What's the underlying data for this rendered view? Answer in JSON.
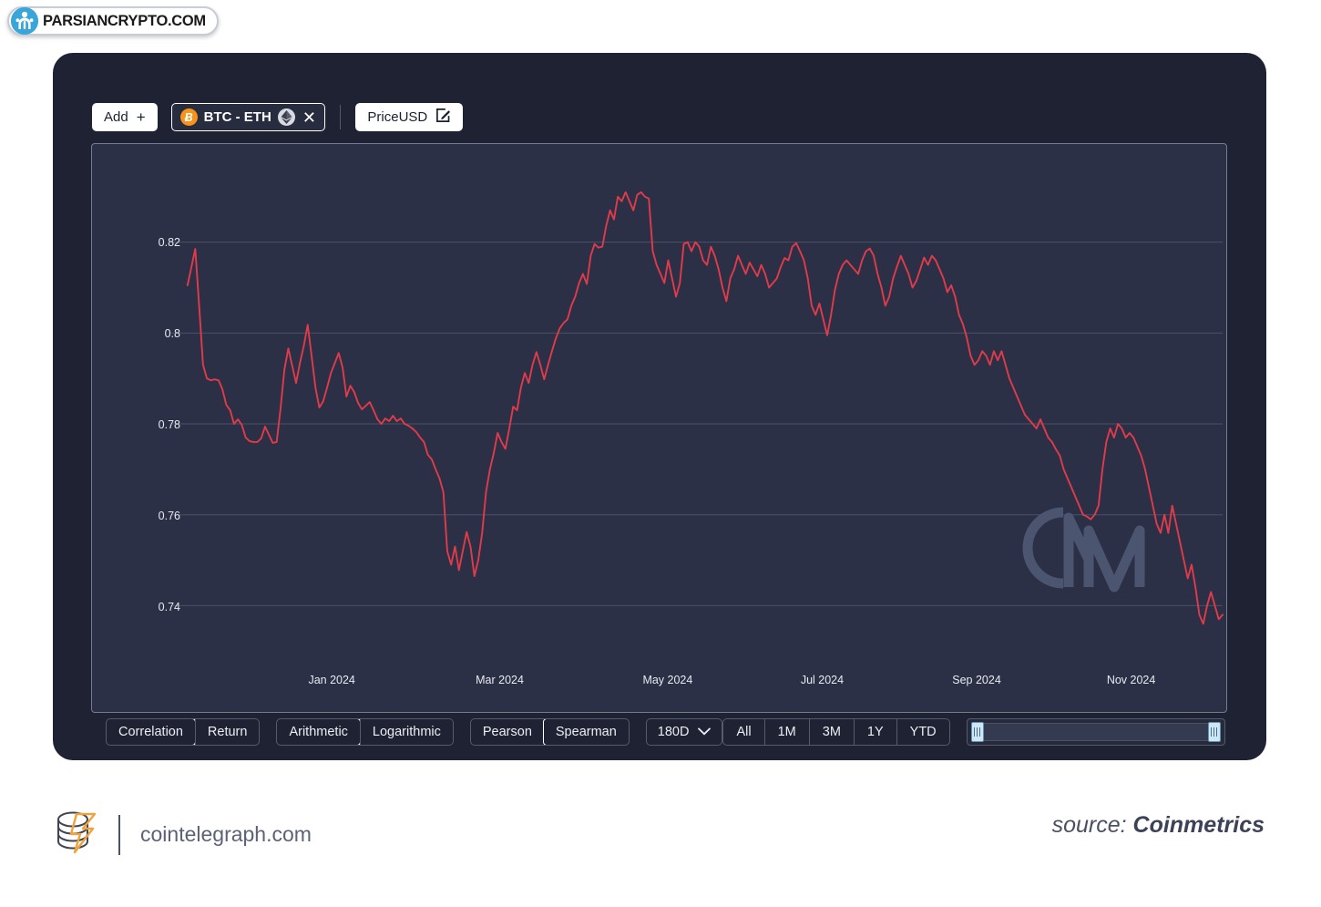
{
  "watermark": {
    "text": "PARSIANCRYPTO.COM",
    "logo_icon": "parsiancrypto-logo-icon"
  },
  "toolbar": {
    "add_label": "Add",
    "add_icon": "plus-icon",
    "asset_chip": {
      "label": "BTC - ETH",
      "base_icon": "bitcoin-icon",
      "base_glyph": "Ƀ",
      "quote_icon": "ethereum-icon",
      "close_icon": "close-icon",
      "close_glyph": "✕"
    },
    "metric_label": "PriceUSD",
    "metric_icon": "edit-pencil-icon"
  },
  "controls": {
    "mode_group": {
      "options": [
        "Correlation",
        "Return"
      ],
      "selected": "Correlation"
    },
    "scale_group": {
      "options": [
        "Arithmetic",
        "Logarithmic"
      ],
      "selected": "Arithmetic"
    },
    "method_group": {
      "options": [
        "Pearson",
        "Spearman"
      ],
      "selected": "Spearman"
    },
    "window_dropdown": {
      "value": "180D",
      "icon": "chevron-down-icon"
    },
    "range_group": {
      "options": [
        "All",
        "1M",
        "3M",
        "1Y",
        "YTD"
      ],
      "selected": ""
    },
    "range_slider": {
      "name": "date-range-slider",
      "left_handle": "slider-handle-left",
      "right_handle": "slider-handle-right"
    }
  },
  "chart_data": {
    "type": "line",
    "title": "",
    "xlabel": "",
    "ylabel": "",
    "series_name": "BTC - ETH PriceUSD Spearman Correlation (180D)",
    "line_color": "#e03b4a",
    "background": "#2b3046",
    "grid": true,
    "legend_position": "none",
    "watermark": "CM",
    "ylim": [
      0.729,
      0.838
    ],
    "yticks": [
      0.82,
      0.8,
      0.78,
      0.76,
      0.74
    ],
    "ytick_labels": [
      "0.82",
      "0.8",
      "0.78",
      "0.76",
      "0.74"
    ],
    "xticks": [
      "Jan 2024",
      "Mar 2024",
      "May 2024",
      "Jul 2024",
      "Sep 2024",
      "Nov 2024"
    ],
    "xtick_positions_pct": [
      13.9,
      30.1,
      46.3,
      61.2,
      76.1,
      91.0
    ],
    "values": [
      0.8105,
      0.8145,
      0.8185,
      0.806,
      0.793,
      0.79,
      0.7896,
      0.7898,
      0.7896,
      0.7876,
      0.7842,
      0.783,
      0.78,
      0.781,
      0.7798,
      0.777,
      0.7762,
      0.776,
      0.776,
      0.7768,
      0.7794,
      0.7776,
      0.7758,
      0.776,
      0.7834,
      0.792,
      0.7966,
      0.7928,
      0.789,
      0.7934,
      0.7972,
      0.8018,
      0.795,
      0.788,
      0.7836,
      0.785,
      0.788,
      0.7912,
      0.7934,
      0.7956,
      0.7924,
      0.786,
      0.7884,
      0.787,
      0.7846,
      0.7832,
      0.784,
      0.7848,
      0.783,
      0.781,
      0.78,
      0.7812,
      0.7806,
      0.7818,
      0.7806,
      0.7812,
      0.78,
      0.7796,
      0.779,
      0.7782,
      0.777,
      0.776,
      0.7732,
      0.7722,
      0.77,
      0.768,
      0.765,
      0.752,
      0.749,
      0.753,
      0.7478,
      0.752,
      0.7562,
      0.753,
      0.7465,
      0.75,
      0.756,
      0.765,
      0.77,
      0.7736,
      0.778,
      0.776,
      0.7745,
      0.779,
      0.7838,
      0.783,
      0.788,
      0.7912,
      0.789,
      0.793,
      0.7958,
      0.793,
      0.7898,
      0.793,
      0.796,
      0.7988,
      0.801,
      0.8022,
      0.803,
      0.806,
      0.808,
      0.811,
      0.813,
      0.8108,
      0.817,
      0.8196,
      0.8188,
      0.819,
      0.8236,
      0.827,
      0.825,
      0.83,
      0.829,
      0.831,
      0.829,
      0.827,
      0.8304,
      0.831,
      0.83,
      0.8296,
      0.818,
      0.815,
      0.813,
      0.811,
      0.816,
      0.812,
      0.808,
      0.811,
      0.8196,
      0.82,
      0.818,
      0.82,
      0.819,
      0.816,
      0.815,
      0.819,
      0.817,
      0.814,
      0.81,
      0.807,
      0.812,
      0.814,
      0.817,
      0.815,
      0.813,
      0.8155,
      0.814,
      0.8125,
      0.815,
      0.813,
      0.81,
      0.811,
      0.812,
      0.8145,
      0.8165,
      0.816,
      0.819,
      0.8198,
      0.818,
      0.816,
      0.812,
      0.806,
      0.804,
      0.8065,
      0.803,
      0.7995,
      0.804,
      0.8095,
      0.813,
      0.815,
      0.816,
      0.815,
      0.814,
      0.813,
      0.816,
      0.818,
      0.8186,
      0.817,
      0.813,
      0.81,
      0.806,
      0.808,
      0.812,
      0.8146,
      0.817,
      0.815,
      0.813,
      0.81,
      0.8115,
      0.814,
      0.8166,
      0.815,
      0.817,
      0.816,
      0.814,
      0.812,
      0.809,
      0.8105,
      0.808,
      0.804,
      0.802,
      0.799,
      0.795,
      0.793,
      0.794,
      0.796,
      0.795,
      0.793,
      0.796,
      0.794,
      0.796,
      0.793,
      0.79,
      0.788,
      0.786,
      0.784,
      0.782,
      0.781,
      0.78,
      0.779,
      0.781,
      0.779,
      0.777,
      0.776,
      0.7744,
      0.773,
      0.77,
      0.768,
      0.766,
      0.764,
      0.762,
      0.76,
      0.7596,
      0.759,
      0.76,
      0.762,
      0.77,
      0.776,
      0.779,
      0.777,
      0.78,
      0.779,
      0.777,
      0.778,
      0.777,
      0.775,
      0.773,
      0.77,
      0.766,
      0.762,
      0.758,
      0.756,
      0.76,
      0.756,
      0.762,
      0.758,
      0.754,
      0.75,
      0.746,
      0.749,
      0.744,
      0.738,
      0.736,
      0.74,
      0.743,
      0.74,
      0.737,
      0.738
    ]
  },
  "footer": {
    "brand_icon": "cointelegraph-logo-icon",
    "brand_name": "cointelegraph.com",
    "source_prefix": "source: ",
    "source_name": "Coinmetrics"
  }
}
